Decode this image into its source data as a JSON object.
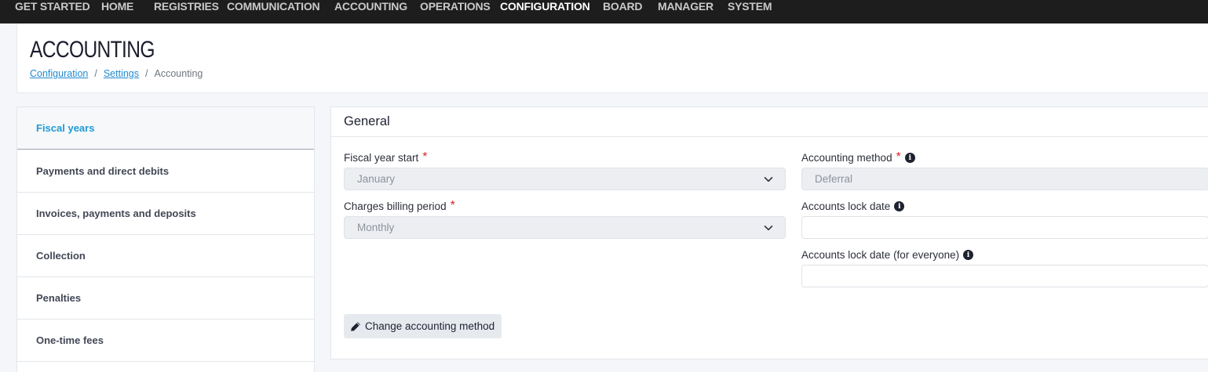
{
  "topnav": {
    "items": [
      {
        "label": "GET STARTED"
      },
      {
        "label": "HOME"
      },
      {
        "label": "REGISTRIES"
      },
      {
        "label": "COMMUNICATION"
      },
      {
        "label": "ACCOUNTING"
      },
      {
        "label": "OPERATIONS"
      },
      {
        "label": "CONFIGURATION",
        "active": true
      },
      {
        "label": "BOARD"
      },
      {
        "label": "MANAGER"
      },
      {
        "label": "SYSTEM"
      }
    ]
  },
  "header": {
    "title": "ACCOUNTING",
    "breadcrumb": {
      "items": [
        {
          "label": "Configuration",
          "link": true
        },
        {
          "label": "Settings",
          "link": true
        },
        {
          "label": "Accounting",
          "link": false
        }
      ],
      "separator": "/"
    }
  },
  "sidebar": {
    "items": [
      {
        "label": "Fiscal years",
        "active": true
      },
      {
        "label": "Payments and direct debits"
      },
      {
        "label": "Invoices, payments and deposits"
      },
      {
        "label": "Collection"
      },
      {
        "label": "Penalties"
      },
      {
        "label": "One-time fees"
      }
    ]
  },
  "general": {
    "title": "General",
    "fiscal_year_start": {
      "label": "Fiscal year start",
      "required_mark": "*",
      "value": "January"
    },
    "charges_billing_period": {
      "label": "Charges billing period",
      "required_mark": "*",
      "value": "Monthly"
    },
    "accounting_method": {
      "label": "Accounting method",
      "required_mark": "*",
      "value": "Deferral"
    },
    "accounts_lock_date": {
      "label": "Accounts lock date",
      "value": ""
    },
    "accounts_lock_date_everyone": {
      "label": "Accounts lock date (for everyone)",
      "value": ""
    },
    "change_method_button": "Change accounting method",
    "info_glyph": "i"
  },
  "colors": {
    "nav_bg": "#1d1d1d",
    "accent": "#1f9ad8",
    "link": "#1f8ad1",
    "required": "#e02424"
  }
}
